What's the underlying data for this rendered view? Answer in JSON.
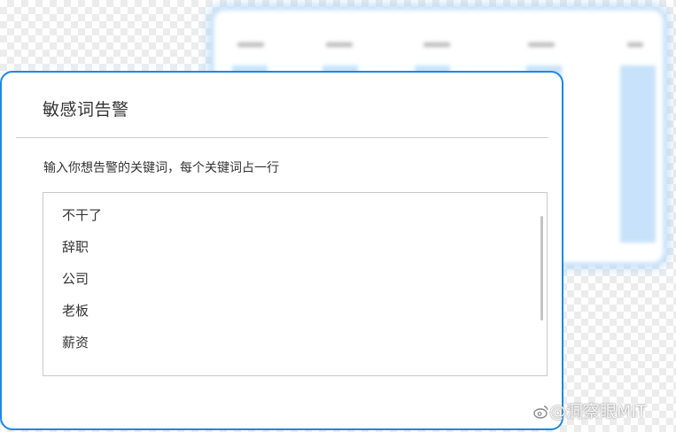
{
  "dialog": {
    "title": "敏感词告警",
    "instruction": "输入你想告警的关键词，每个关键词占一行",
    "keywords": [
      "不干了",
      "辞职",
      "公司",
      "老板",
      "薪资"
    ],
    "border_color": "#1e88e5"
  },
  "watermark": {
    "text": "@洞察眼MIT",
    "icon": "weibo-logo-icon"
  }
}
